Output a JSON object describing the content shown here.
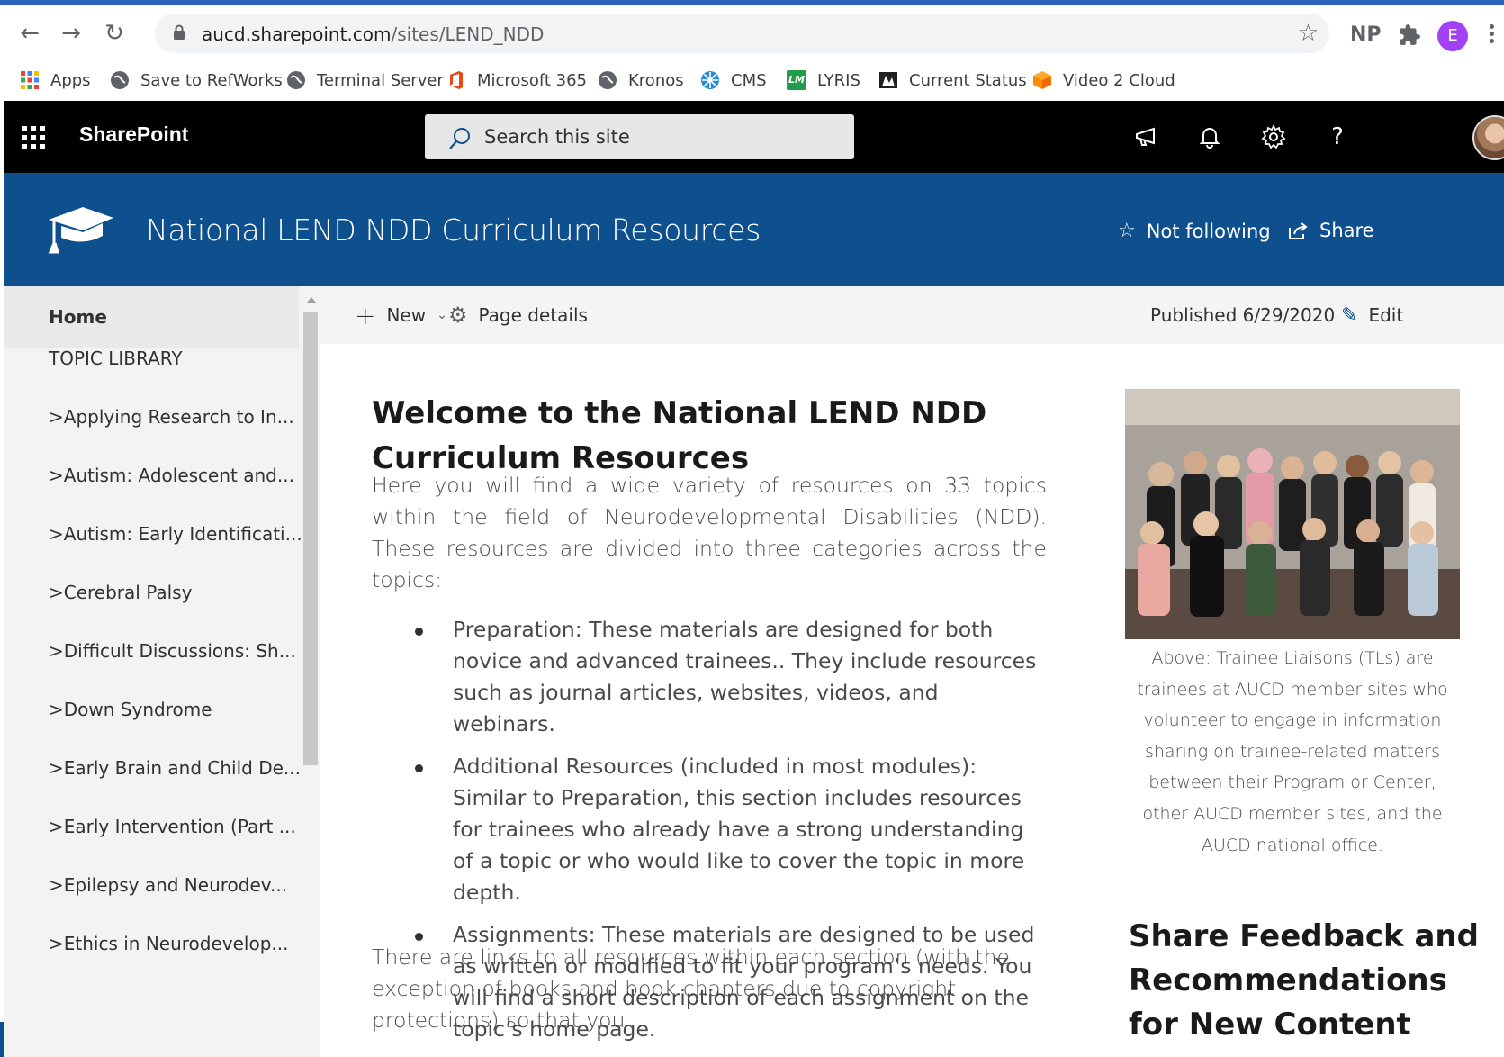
{
  "browser": {
    "url_host": "aucd.sharepoint.com",
    "url_path": "/sites/LEND_NDD",
    "extensions": [
      "NP"
    ],
    "profile_initial": "E",
    "bookmarks": [
      "Apps",
      "Save to RefWorks",
      "Terminal Server",
      "Microsoft 365",
      "Kronos",
      "CMS",
      "LYRIS",
      "Current Status",
      "Video 2 Cloud"
    ],
    "lyris_badge": "LM"
  },
  "suite": {
    "brand": "SharePoint",
    "search_placeholder": "Search this site"
  },
  "site": {
    "title": "National LEND NDD Curriculum Resources",
    "follow_label": "Not following",
    "share_label": "Share"
  },
  "nav": {
    "home": "Home",
    "section": "TOPIC LIBRARY",
    "items": [
      ">Applying Research to In...",
      ">Autism: Adolescent and...",
      ">Autism: Early Identificati...",
      ">Cerebral Palsy",
      ">Difficult Discussions: Sh...",
      ">Down Syndrome",
      ">Early Brain and Child De...",
      ">Early Intervention (Part ...",
      ">Epilepsy and Neurodev...",
      ">Ethics in Neurodevelop..."
    ]
  },
  "commandbar": {
    "new_label": "New",
    "page_details_label": "Page details",
    "published": "Published 6/29/2020",
    "edit_label": "Edit"
  },
  "content": {
    "welcome_title": "Welcome to the National LEND NDD Curriculum Resources",
    "intro": "Here you will find a wide variety of resources on 33 topics within the field of Neurodevelopmental Disabilities (NDD). These resources are divided into three categories across the topics:",
    "bullets": [
      "Preparation: These materials are designed for both novice and advanced trainees..  They include resources such as journal articles, websites, videos, and webinars.",
      "Additional Resources (included in most modules): Similar to Preparation, this section includes resources for trainees who already have a strong understanding of a topic or who would like to cover the topic in more depth.",
      "Assignments: These materials are designed to be used as written or modified to fit your program’s needs. You will find a short description of each assignment on the topic’s home page."
    ],
    "links_text": "There are links to all resources within each section (with the exception of books and book chapters due to copyright protections) so that you",
    "photo_caption": "Above: Trainee Liaisons (TLs) are trainees at AUCD member sites who volunteer to engage in information sharing on trainee-related matters between their Program or Center, other AUCD member sites, and the AUCD national office.",
    "feedback_title": "Share Feedback and Recommendations for New Content"
  },
  "colors": {
    "suite_bar": "#000000",
    "site_header": "#0e4f8d",
    "nav_bg": "#f3f3f3",
    "profile": "#a142f4"
  }
}
